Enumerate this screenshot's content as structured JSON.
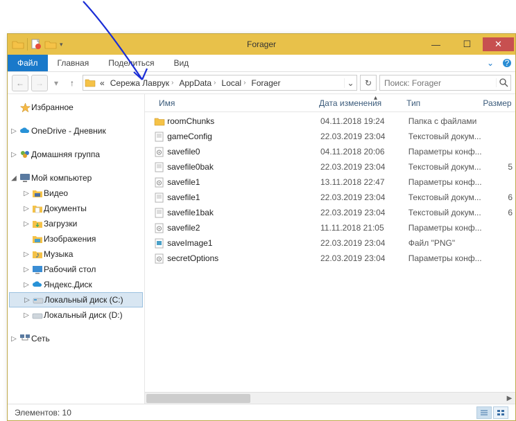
{
  "window": {
    "title": "Forager"
  },
  "ribbon": {
    "file": "Файл",
    "tabs": [
      "Главная",
      "Поделиться",
      "Вид"
    ]
  },
  "breadcrumbs": {
    "prefix": "«",
    "items": [
      "Сережа Лаврук",
      "AppData",
      "Local",
      "Forager"
    ]
  },
  "search": {
    "placeholder": "Поиск: Forager"
  },
  "columns": {
    "name": "Имя",
    "date": "Дата изменения",
    "type": "Тип",
    "size": "Размер"
  },
  "sidebar": {
    "favorites": "Избранное",
    "onedrive": "OneDrive - Дневник",
    "homegroup": "Домашняя группа",
    "mycomputer": "Мой компьютер",
    "items": [
      {
        "label": "Видео",
        "kind": "video"
      },
      {
        "label": "Документы",
        "kind": "docs"
      },
      {
        "label": "Загрузки",
        "kind": "downloads"
      },
      {
        "label": "Изображения",
        "kind": "pictures"
      },
      {
        "label": "Музыка",
        "kind": "music"
      },
      {
        "label": "Рабочий стол",
        "kind": "desktop"
      },
      {
        "label": "Яндекс.Диск",
        "kind": "yadisk"
      },
      {
        "label": "Локальный диск (C:)",
        "kind": "drive"
      },
      {
        "label": "Локальный диск (D:)",
        "kind": "drive"
      }
    ],
    "network": "Сеть"
  },
  "files": [
    {
      "name": "roomChunks",
      "date": "04.11.2018 19:24",
      "type": "Папка с файлами",
      "size": "",
      "kind": "folder"
    },
    {
      "name": "gameConfig",
      "date": "22.03.2019 23:04",
      "type": "Текстовый докум...",
      "size": "",
      "kind": "txt"
    },
    {
      "name": "savefile0",
      "date": "04.11.2018 20:06",
      "type": "Параметры конф...",
      "size": "",
      "kind": "ini"
    },
    {
      "name": "savefile0bak",
      "date": "22.03.2019 23:04",
      "type": "Текстовый докум...",
      "size": "5",
      "kind": "txt"
    },
    {
      "name": "savefile1",
      "date": "13.11.2018 22:47",
      "type": "Параметры конф...",
      "size": "",
      "kind": "ini"
    },
    {
      "name": "savefile1",
      "date": "22.03.2019 23:04",
      "type": "Текстовый докум...",
      "size": "6",
      "kind": "txt"
    },
    {
      "name": "savefile1bak",
      "date": "22.03.2019 23:04",
      "type": "Текстовый докум...",
      "size": "6",
      "kind": "txt"
    },
    {
      "name": "savefile2",
      "date": "11.11.2018 21:05",
      "type": "Параметры конф...",
      "size": "",
      "kind": "ini"
    },
    {
      "name": "saveImage1",
      "date": "22.03.2019 23:04",
      "type": "Файл \"PNG\"",
      "size": "",
      "kind": "png"
    },
    {
      "name": "secretOptions",
      "date": "22.03.2019 23:04",
      "type": "Параметры конф...",
      "size": "",
      "kind": "ini"
    }
  ],
  "status": {
    "elements_label": "Элементов:",
    "count": "10"
  }
}
